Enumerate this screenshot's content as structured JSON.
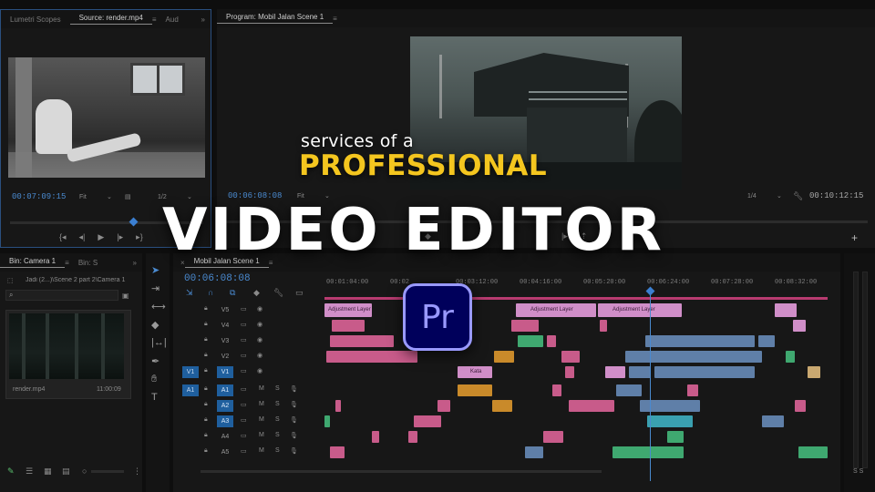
{
  "source_panel": {
    "tabs": [
      "Lumetri Scopes",
      "Source: render.mp4",
      "Aud"
    ],
    "timecode": "00:07:09:15",
    "fit": "Fit",
    "resolution": "1/2"
  },
  "program_panel": {
    "tab": "Program: Mobil Jalan Scene 1",
    "timecode": "00:06:08:08",
    "fit": "Fit",
    "resolution": "1/4",
    "duration": "00:10:12:15"
  },
  "bin_panel": {
    "tabs": [
      "Bin: Camera 1",
      "Bin: S"
    ],
    "path": "Jadi (2...)\\Scene 2 part 2\\Camera 1",
    "clip_name": "render.mp4",
    "clip_duration": "11:00:09"
  },
  "timeline": {
    "tab": "Mobil Jalan Scene 1",
    "timecode": "00:06:08:08",
    "ruler": [
      "00:01:04:00",
      "00:02",
      "00:03:12:00",
      "00:04:16:00",
      "00:05:20:00",
      "00:06:24:00",
      "00:07:28:00",
      "00:08:32:00"
    ],
    "video_tracks": [
      "V5",
      "V4",
      "V3",
      "V2",
      "V1"
    ],
    "audio_tracks": [
      "A1",
      "A2",
      "A3",
      "A4",
      "A5"
    ],
    "source_v": "V1",
    "source_a": "A1",
    "m_label": "M",
    "s_label": "S",
    "adjustment_label": "Adjustment Layer",
    "clip_kata": "Kata"
  },
  "meters": {
    "label": "S S"
  },
  "overlay": {
    "line1": "services of a",
    "line2": "PROFESSIONAL",
    "line3": "VIDEO EDITOR",
    "logo": "Pr"
  },
  "colors": {
    "accent_blue": "#4a8ad0",
    "headline_yellow": "#f4c61f",
    "clip_pink": "#d08ec8",
    "clip_blue": "#5f7fa8",
    "clip_green": "#3fa870",
    "clip_orange": "#c98a2a",
    "clip_rose": "#c85b8a",
    "premiere_bg": "#00005b",
    "premiere_fg": "#9999ff"
  }
}
